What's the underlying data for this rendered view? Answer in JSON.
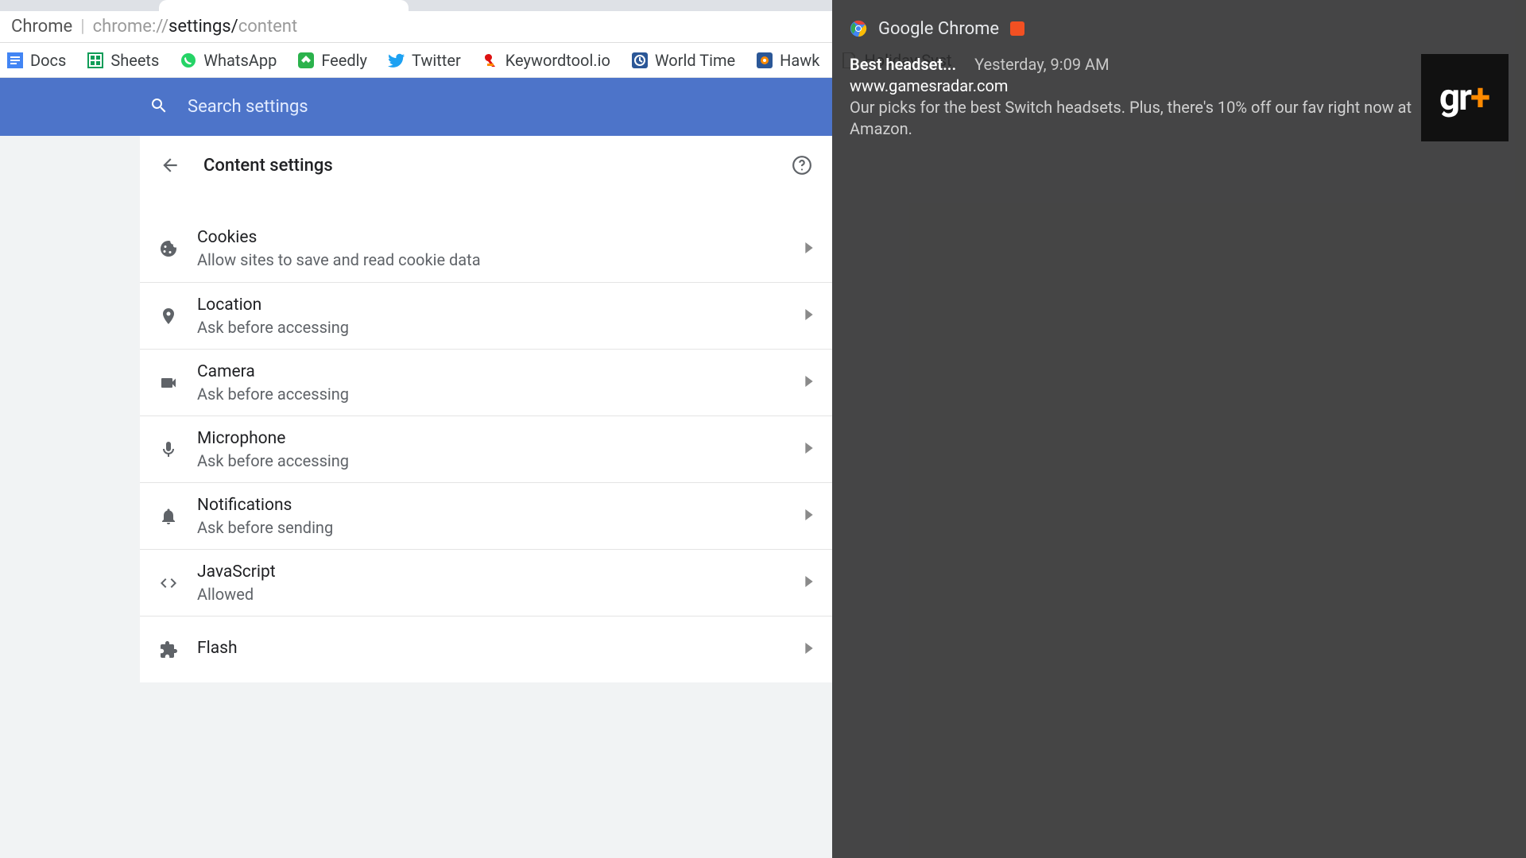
{
  "omnibox": {
    "app_name": "Chrome",
    "url_dim_prefix": "chrome://",
    "url_dark": "settings/",
    "url_dim_suffix": "content"
  },
  "bookmarks": [
    {
      "label": "Docs"
    },
    {
      "label": "Sheets"
    },
    {
      "label": "WhatsApp"
    },
    {
      "label": "Feedly"
    },
    {
      "label": "Twitter"
    },
    {
      "label": "Keywordtool.io"
    },
    {
      "label": "World Time"
    },
    {
      "label": "Hawk"
    },
    {
      "label": "Holiday Syst"
    }
  ],
  "header": {
    "search_placeholder": "Search settings"
  },
  "page": {
    "title": "Content settings"
  },
  "settings": [
    {
      "icon": "cookie",
      "title": "Cookies",
      "sub": "Allow sites to save and read cookie data"
    },
    {
      "icon": "location",
      "title": "Location",
      "sub": "Ask before accessing"
    },
    {
      "icon": "camera",
      "title": "Camera",
      "sub": "Ask before accessing"
    },
    {
      "icon": "mic",
      "title": "Microphone",
      "sub": "Ask before accessing"
    },
    {
      "icon": "bell",
      "title": "Notifications",
      "sub": "Ask before sending"
    },
    {
      "icon": "code",
      "title": "JavaScript",
      "sub": "Allowed"
    },
    {
      "icon": "plugin",
      "title": "Flash",
      "sub": ""
    }
  ],
  "notif": {
    "app": "Google Chrome",
    "title": "Best headset...",
    "time": "Yesterday, 9:09 AM",
    "site": "www.gamesradar.com",
    "body": "Our picks for the best Switch headsets. Plus, there's 10% off our fav right now at Amazon.",
    "thumb": {
      "gr": "gr",
      "plus": "+"
    }
  }
}
